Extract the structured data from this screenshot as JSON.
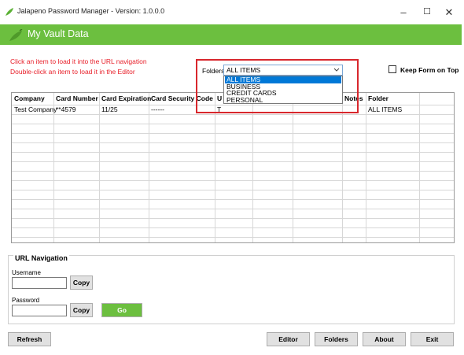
{
  "window": {
    "title": "Jalapeno Password Manager -  Version: 1.0.0.0",
    "min_glyph": "–",
    "max_glyph": "☐",
    "close_glyph": "✕"
  },
  "header": {
    "title": "My Vault Data"
  },
  "hints": {
    "line1": "Click an item to load it into the URL navigation",
    "line2": "Double-click an item to load it in the Editor"
  },
  "folders": {
    "label": "Folders",
    "selected": "ALL ITEMS",
    "options": [
      "ALL ITEMS",
      "BUSINESS",
      "CREDIT CARDS",
      "PERSONAL"
    ]
  },
  "keep_on_top": {
    "label": "Keep Form on Top",
    "checked": false
  },
  "table": {
    "columns": [
      "Company",
      "Card Number",
      "Card Expiration",
      "Card Security Code",
      "U",
      "",
      "",
      "Notes",
      "Folder"
    ],
    "rows": [
      [
        "Test Company",
        "**4579",
        "11/25",
        "------",
        "T",
        "",
        "",
        "",
        "ALL ITEMS"
      ]
    ]
  },
  "url_nav": {
    "title": "URL Navigation",
    "username_label": "Username",
    "username_value": "",
    "password_label": "Password",
    "password_value": "",
    "copy_label": "Copy",
    "go_label": "Go"
  },
  "bottom": {
    "refresh": "Refresh",
    "editor": "Editor",
    "folders": "Folders",
    "about": "About",
    "exit": "Exit"
  },
  "colors": {
    "accent": "#6cbf3f",
    "hint": "#e8202a",
    "highlight_box": "#d8272d",
    "selection": "#0078d7"
  }
}
